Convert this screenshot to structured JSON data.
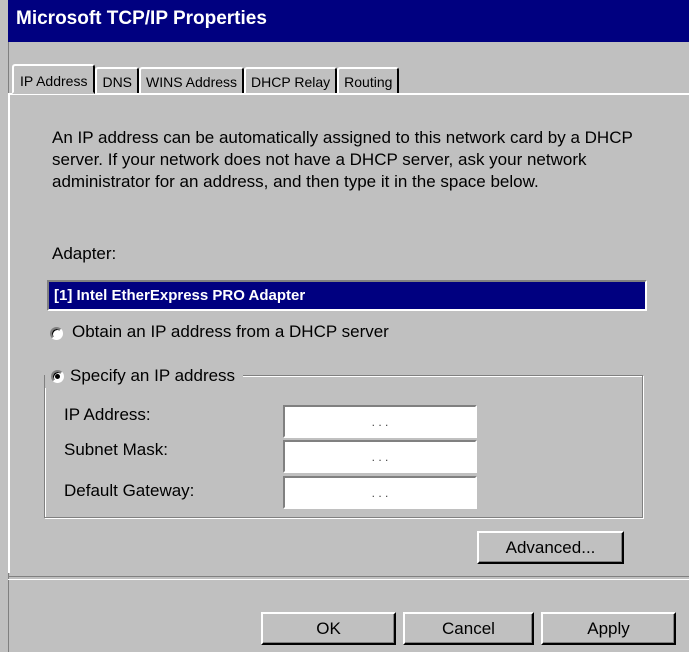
{
  "window": {
    "title": "Microsoft TCP/IP Properties"
  },
  "tabs": [
    {
      "label": "IP Address",
      "active": true
    },
    {
      "label": "DNS",
      "active": false
    },
    {
      "label": "WINS Address",
      "active": false
    },
    {
      "label": "DHCP Relay",
      "active": false
    },
    {
      "label": "Routing",
      "active": false
    }
  ],
  "ip_address_tab": {
    "description": "An IP address can be automatically assigned to this network card by a DHCP server. If your network does not have a DHCP server, ask your network administrator for an address, and then type it in the space below.",
    "adapter_label": "Adapter:",
    "adapter_value": "[1] Intel EtherExpress PRO Adapter",
    "radio_dhcp": {
      "label": "Obtain an IP address from a DHCP server",
      "checked": false
    },
    "radio_specify": {
      "label": "Specify an IP address",
      "checked": true
    },
    "fields": [
      {
        "label": "IP Address:",
        "value": ". . ."
      },
      {
        "label": "Subnet Mask:",
        "value": ". . ."
      },
      {
        "label": "Default Gateway:",
        "value": ". . ."
      }
    ],
    "advanced_button": "Advanced..."
  },
  "footer": {
    "ok": "OK",
    "cancel": "Cancel",
    "apply": "Apply"
  }
}
